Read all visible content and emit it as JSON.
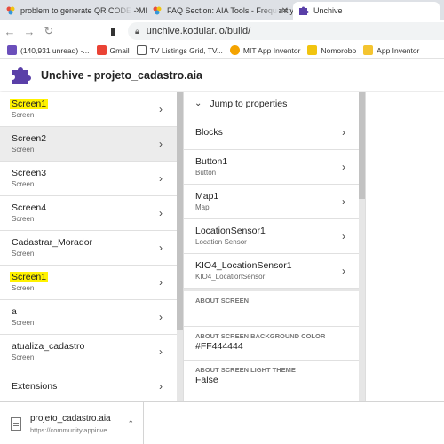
{
  "browser": {
    "tabs": [
      {
        "title": "problem to generate QR CODE - MIT"
      },
      {
        "title": "FAQ Section: AIA Tools - Frequently A"
      },
      {
        "title": "Unchive"
      }
    ],
    "url": "unchive.kodular.io/build/",
    "bookmarks": [
      {
        "label": "(140,931 unread) -...",
        "color": "#6b4fbb"
      },
      {
        "label": "Gmail",
        "color": "#ea4335"
      },
      {
        "label": "TV Listings Grid, TV...",
        "color": "#555555"
      },
      {
        "label": "MIT App Inventor",
        "color": "#f4a300"
      },
      {
        "label": "Nomorobo",
        "color": "#f1c40f"
      },
      {
        "label": "App Inventor",
        "color": "#f4c430"
      }
    ]
  },
  "app": {
    "title": "Unchive - projeto_cadastro.aia"
  },
  "screens": [
    {
      "name": "Screen1",
      "type": "Screen",
      "highlight": true
    },
    {
      "name": "Screen2",
      "type": "Screen",
      "highlight": false
    },
    {
      "name": "Screen3",
      "type": "Screen",
      "highlight": false
    },
    {
      "name": "Screen4",
      "type": "Screen",
      "highlight": false
    },
    {
      "name": "Cadastrar_Morador",
      "type": "Screen",
      "highlight": false
    },
    {
      "name": "Screen1",
      "type": "Screen",
      "highlight": true
    },
    {
      "name": "a",
      "type": "Screen",
      "highlight": false
    },
    {
      "name": "atualiza_cadastro",
      "type": "Screen",
      "highlight": false
    },
    {
      "name": "Extensions",
      "type": "",
      "highlight": false
    }
  ],
  "components": {
    "jump_label": "Jump to properties",
    "items": [
      {
        "name": "Blocks",
        "type": ""
      },
      {
        "name": "Button1",
        "type": "Button"
      },
      {
        "name": "Map1",
        "type": "Map"
      },
      {
        "name": "LocationSensor1",
        "type": "Location Sensor"
      },
      {
        "name": "KIO4_LocationSensor1",
        "type": "KIO4_LocationSensor"
      }
    ],
    "about_label": "ABOUT SCREEN",
    "bg_color_label": "ABOUT SCREEN BACKGROUND COLOR",
    "bg_color_value": "#FF444444",
    "light_theme_label": "ABOUT SCREEN LIGHT THEME",
    "light_theme_value": "False"
  },
  "download": {
    "filename": "projeto_cadastro.aia",
    "source": "https://community.appinve..."
  },
  "colors": {
    "highlight": "#fff200",
    "selected_row": "#ececec",
    "puzzle_logo": "#5a3fa8"
  }
}
